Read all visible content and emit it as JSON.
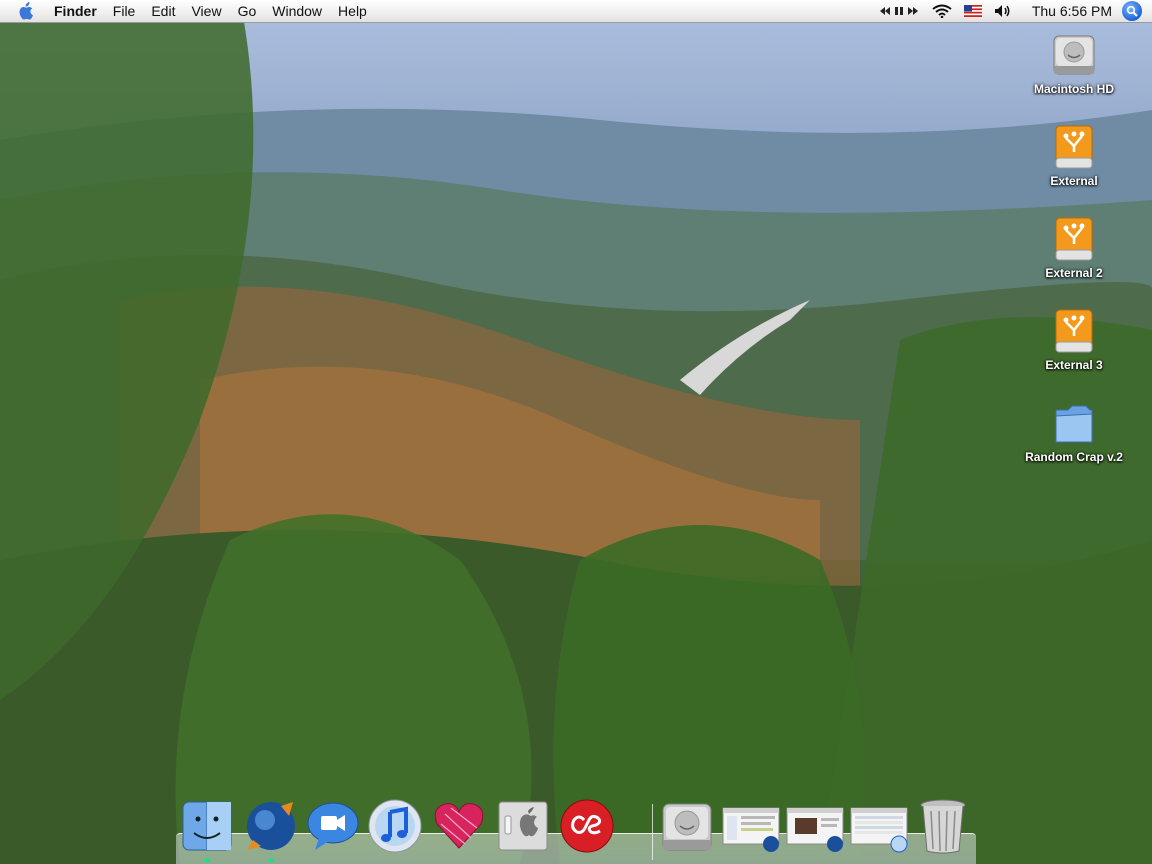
{
  "menubar": {
    "app_name": "Finder",
    "items": [
      "File",
      "Edit",
      "View",
      "Go",
      "Window",
      "Help"
    ],
    "clock": "Thu 6:56 PM",
    "status_icons": [
      "media-controls-icon",
      "wifi-icon",
      "us-flag-icon",
      "volume-icon",
      "spotlight-icon"
    ]
  },
  "desktop": {
    "icons": [
      {
        "label": "Macintosh HD",
        "icon": "hard-drive-icon"
      },
      {
        "label": "External",
        "icon": "firewire-drive-icon"
      },
      {
        "label": "External 2",
        "icon": "firewire-drive-icon"
      },
      {
        "label": "External 3",
        "icon": "firewire-drive-icon"
      },
      {
        "label": "Random Crap v.2",
        "icon": "folder-icon"
      }
    ]
  },
  "dock": {
    "apps": [
      "finder-icon",
      "camino-icon",
      "ichat-icon",
      "itunes-icon",
      "heart-app-icon",
      "system-preferences-icon",
      "lastfm-icon"
    ],
    "docs": [
      "hard-drive-icon",
      "window-thumbnail-icon",
      "window-thumbnail-icon",
      "window-thumbnail-icon",
      "trash-icon"
    ]
  },
  "colors": {
    "accent": "#1d63d8",
    "drive_orange": "#f39a1c",
    "running_indicator": "#22dd88"
  }
}
